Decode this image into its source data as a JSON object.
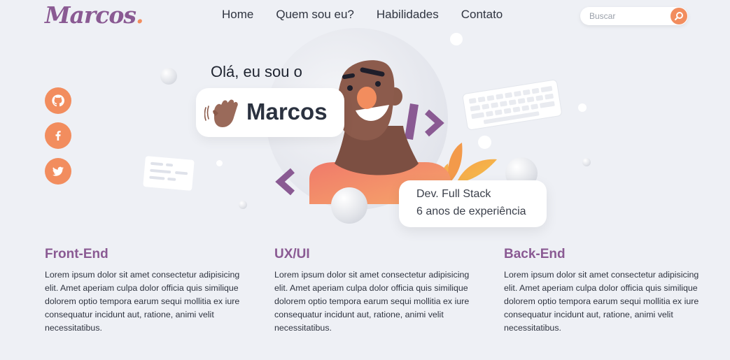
{
  "header": {
    "logo_text": "Marcos",
    "logo_dot": ".",
    "nav": [
      "Home",
      "Quem sou eu?",
      "Habilidades",
      "Contato"
    ],
    "search_placeholder": "Buscar"
  },
  "social": [
    {
      "icon": "github-icon"
    },
    {
      "icon": "facebook-icon"
    },
    {
      "icon": "twitter-icon"
    }
  ],
  "hero": {
    "greeting": "Olá, eu sou o",
    "name": "Marcos",
    "role": "Dev. Full Stack",
    "experience": "6 anos de experiência"
  },
  "sections": [
    {
      "title": "Front-End",
      "text": "Lorem ipsum dolor sit amet consectetur adipisicing elit. Amet aperiam culpa dolor officia quis similique dolorem optio tempora earum sequi mollitia ex iure consequatur incidunt aut, ratione, animi velit necessitatibus."
    },
    {
      "title": "UX/UI",
      "text": "Lorem ipsum dolor sit amet consectetur adipisicing elit. Amet aperiam culpa dolor officia quis similique dolorem optio tempora earum sequi mollitia ex iure consequatur incidunt aut, ratione, animi velit necessitatibus."
    },
    {
      "title": "Back-End",
      "text": "Lorem ipsum dolor sit amet consectetur adipisicing elit. Amet aperiam culpa dolor officia quis similique dolorem optio tempora earum sequi mollitia ex iure consequatur incidunt aut, ratione, animi velit necessitatibus."
    }
  ],
  "colors": {
    "background": "#eef0f5",
    "accent_orange": "#f28d5e",
    "accent_purple": "#8a5a93",
    "text_dark": "#2f3440"
  }
}
